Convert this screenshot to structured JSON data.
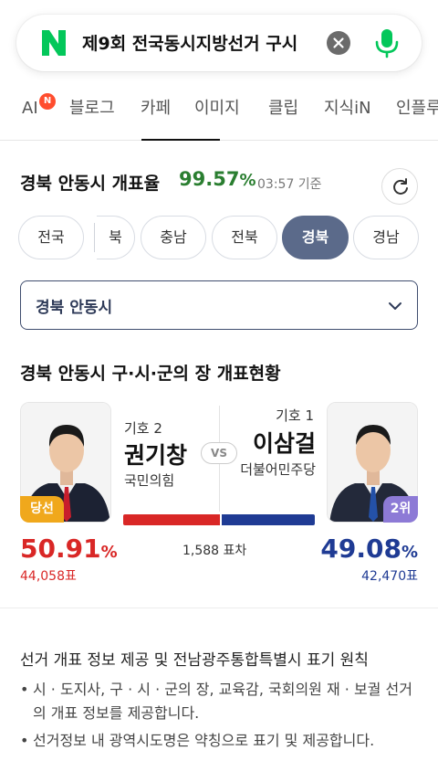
{
  "search": {
    "query": "제9회 전국동시지방선거 구시",
    "logo_letter": "N",
    "logo_color": "#03c75a",
    "mic_color": "#03c75a"
  },
  "tabs": [
    {
      "label": "AI",
      "badge": "N"
    },
    {
      "label": "블로그"
    },
    {
      "label": "카페",
      "selected": true
    },
    {
      "label": "이미지"
    },
    {
      "label": "클립"
    },
    {
      "label": "지식iN"
    },
    {
      "label": "인플루"
    }
  ],
  "count": {
    "title": "경북 안동시 개표율",
    "rate": "99.57",
    "rate_unit": "%",
    "time": "03:57 기준",
    "rate_color": "#2a7e30"
  },
  "regions": {
    "items": [
      "전국",
      "북",
      "충남",
      "전북",
      "경북",
      "경남"
    ],
    "selected": "경북"
  },
  "select": {
    "value": "경북 안동시"
  },
  "race": {
    "title": "경북 안동시 구·시·군의 장 개표현황",
    "vs_label": "VS",
    "margin": "1,588 표차",
    "left": {
      "number": "기호 2",
      "name": "권기창",
      "party": "국민의힘",
      "badge": "당선",
      "pct": "50.91",
      "pct_unit": "%",
      "votes": "44,058표",
      "color": "#d92726",
      "share": 50.91
    },
    "right": {
      "number": "기호 1",
      "name": "이삼걸",
      "party": "더불어민주당",
      "badge": "2위",
      "pct": "49.08",
      "pct_unit": "%",
      "votes": "42,470표",
      "color": "#1f3b94",
      "share": 49.08
    }
  },
  "notice": {
    "title": "선거 개표 정보 제공 및 전남광주통합특별시 표기 원칙",
    "bullets": [
      "시 · 도지사, 구 · 시 · 군의 장, 교육감, 국회의원 재 · 보궐 선거의 개표 정보를 제공합니다.",
      "선거정보 내 광역시도명은 약칭으로 표기 및 제공합니다."
    ]
  }
}
